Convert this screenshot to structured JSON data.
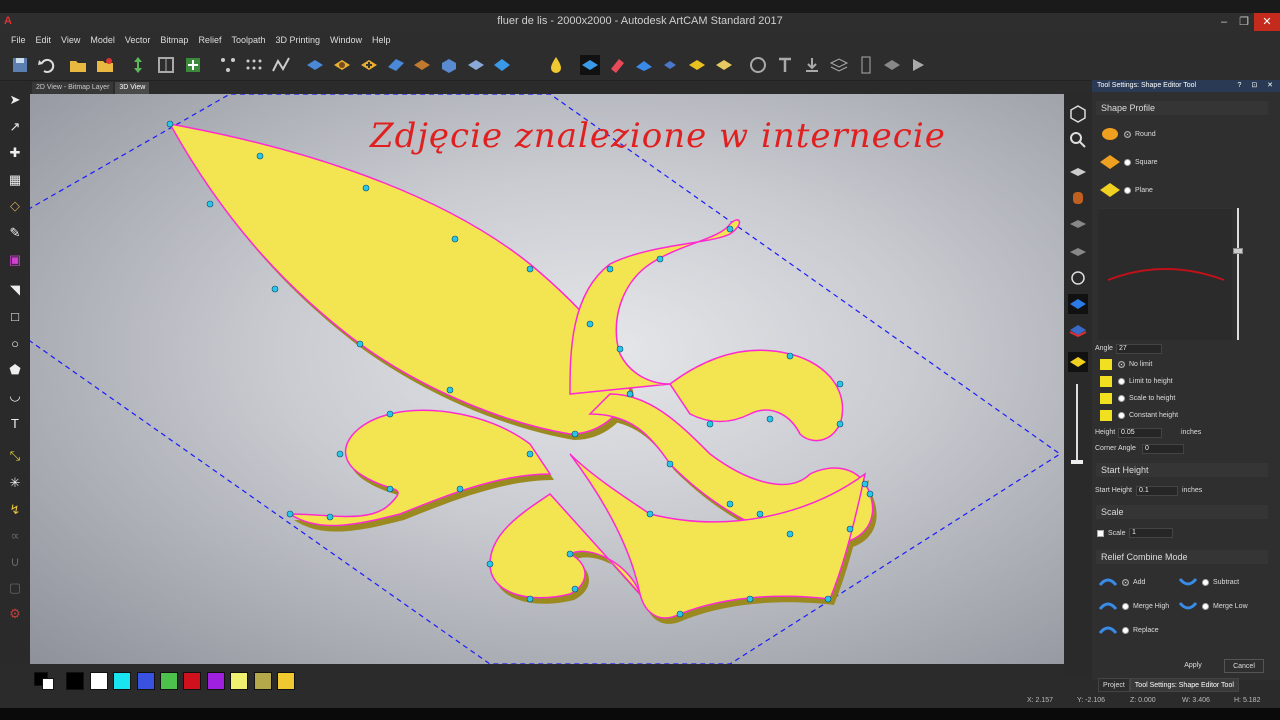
{
  "window": {
    "title": "fluer de lis - 2000x2000 - Autodesk ArtCAM Standard 2017",
    "app_icon": "A"
  },
  "menu": [
    "File",
    "Edit",
    "View",
    "Model",
    "Vector",
    "Bitmap",
    "Relief",
    "Toolpath",
    "3D Printing",
    "Window",
    "Help"
  ],
  "view_tabs": [
    "2D View - Bitmap Layer",
    "3D View"
  ],
  "active_view_tab": "3D View",
  "watermark": "Zdjęcie znalezione w internecie",
  "panel": {
    "header": "Tool Settings: Shape Editor Tool",
    "shape_profile": {
      "title": "Shape Profile",
      "options": [
        "Round",
        "Square",
        "Plane"
      ],
      "selected": "Round"
    },
    "angle_label": "Angle",
    "angle_value": "27",
    "limit_options": [
      "No limit",
      "Limit to height",
      "Scale to height",
      "Constant height"
    ],
    "limit_selected": "No limit",
    "height_label": "Height",
    "height_value": "0.05",
    "height_unit": "inches",
    "corner_angle_label": "Corner Angle",
    "corner_angle_value": "0",
    "start_height": {
      "title": "Start Height",
      "label": "Start Height",
      "value": "0.1",
      "unit": "inches"
    },
    "scale": {
      "title": "Scale",
      "checkbox_label": "Scale",
      "value": "1"
    },
    "combine": {
      "title": "Relief Combine Mode",
      "options": [
        "Add",
        "Subtract",
        "Merge High",
        "Merge Low",
        "Replace"
      ],
      "selected": "Add"
    },
    "apply_label": "Apply",
    "cancel_label": "Cancel"
  },
  "bottom_tabs": [
    "Project",
    "Tool Settings: Shape Editor Tool"
  ],
  "palette_colors": [
    "#000000",
    "#ffffff",
    "#19e5f0",
    "#3a52e0",
    "#4cc24c",
    "#d0101c",
    "#a020e0",
    "#f0f070",
    "#b4a84a",
    "#f0c830"
  ],
  "status": {
    "x": "X: 2.157",
    "y": "Y: -2.106",
    "z": "Z: 0.000",
    "w": "W: 3.406",
    "h": "H: 5.182"
  },
  "colors": {
    "accent_header": "#2a3a55",
    "watermark": "#e02020",
    "relief": "#f0e040",
    "vector_outline": "#ff2ad0",
    "nodes": "#29c6e8"
  }
}
